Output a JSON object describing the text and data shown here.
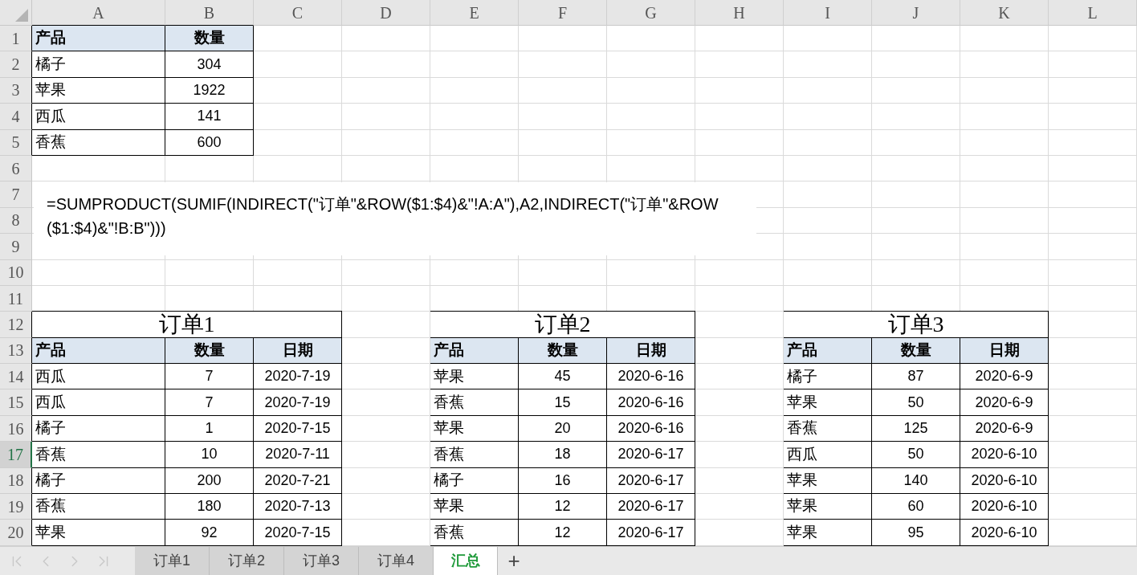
{
  "column_headers": [
    {
      "label": "A"
    },
    {
      "label": "B"
    },
    {
      "label": "C"
    },
    {
      "label": "D"
    },
    {
      "label": "E"
    },
    {
      "label": "F"
    },
    {
      "label": "G"
    },
    {
      "label": "H"
    },
    {
      "label": "I"
    },
    {
      "label": "J"
    },
    {
      "label": "K"
    },
    {
      "label": "L"
    }
  ],
  "rows": [
    {
      "number": "1",
      "selected": false,
      "cells": [
        {
          "kind": "label_header",
          "text": "产品"
        },
        {
          "kind": "value_header",
          "text": "数量"
        }
      ]
    },
    {
      "number": "2",
      "selected": false,
      "cells": [
        {
          "kind": "text",
          "text": "橘子"
        },
        {
          "kind": "number",
          "text": "304"
        }
      ]
    },
    {
      "number": "3",
      "selected": false,
      "cells": [
        {
          "kind": "text",
          "text": "苹果"
        },
        {
          "kind": "number",
          "text": "1922"
        }
      ]
    },
    {
      "number": "4",
      "selected": false,
      "cells": [
        {
          "kind": "text",
          "text": "西瓜"
        },
        {
          "kind": "number",
          "text": "141"
        }
      ]
    },
    {
      "number": "5",
      "selected": false,
      "cells": [
        {
          "kind": "text",
          "text": "香蕉"
        },
        {
          "kind": "number",
          "text": "600"
        }
      ]
    },
    {
      "number": "6",
      "selected": false
    },
    {
      "number": "7",
      "selected": false
    },
    {
      "number": "8",
      "selected": false
    },
    {
      "number": "9",
      "selected": false
    },
    {
      "number": "10",
      "selected": false
    },
    {
      "number": "11",
      "selected": false
    },
    {
      "number": "12",
      "selected": false,
      "cells": [
        {
          "kind": "title",
          "text": "订单1"
        },
        {
          "kind": "merged"
        },
        {
          "kind": "merged"
        },
        {
          "kind": "empty"
        },
        {
          "kind": "title",
          "text": "订单2"
        },
        {
          "kind": "merged"
        },
        {
          "kind": "merged"
        },
        {
          "kind": "empty"
        },
        {
          "kind": "title",
          "text": "订单3"
        },
        {
          "kind": "merged"
        },
        {
          "kind": "merged"
        }
      ]
    },
    {
      "number": "13",
      "selected": false,
      "cells": [
        {
          "kind": "label_header",
          "text": "产品"
        },
        {
          "kind": "value_header",
          "text": "数量"
        },
        {
          "kind": "value_header",
          "text": "日期"
        },
        {
          "kind": "empty"
        },
        {
          "kind": "label_header",
          "text": "产品"
        },
        {
          "kind": "value_header",
          "text": "数量"
        },
        {
          "kind": "value_header",
          "text": "日期"
        },
        {
          "kind": "empty"
        },
        {
          "kind": "label_header",
          "text": "产品"
        },
        {
          "kind": "value_header",
          "text": "数量"
        },
        {
          "kind": "value_header",
          "text": "日期"
        }
      ]
    },
    {
      "number": "14",
      "selected": false,
      "cells": [
        {
          "kind": "text",
          "text": "西瓜"
        },
        {
          "kind": "number",
          "text": "7"
        },
        {
          "kind": "date",
          "text": "2020-7-19"
        },
        {
          "kind": "empty"
        },
        {
          "kind": "text",
          "text": "苹果"
        },
        {
          "kind": "number",
          "text": "45"
        },
        {
          "kind": "date",
          "text": "2020-6-16"
        },
        {
          "kind": "empty"
        },
        {
          "kind": "text",
          "text": "橘子"
        },
        {
          "kind": "number",
          "text": "87"
        },
        {
          "kind": "date",
          "text": "2020-6-9"
        }
      ]
    },
    {
      "number": "15",
      "selected": false,
      "cells": [
        {
          "kind": "text",
          "text": "西瓜"
        },
        {
          "kind": "number",
          "text": "7"
        },
        {
          "kind": "date",
          "text": "2020-7-19"
        },
        {
          "kind": "empty"
        },
        {
          "kind": "text",
          "text": "香蕉"
        },
        {
          "kind": "number",
          "text": "15"
        },
        {
          "kind": "date",
          "text": "2020-6-16"
        },
        {
          "kind": "empty"
        },
        {
          "kind": "text",
          "text": "苹果"
        },
        {
          "kind": "number",
          "text": "50"
        },
        {
          "kind": "date",
          "text": "2020-6-9"
        }
      ]
    },
    {
      "number": "16",
      "selected": false,
      "cells": [
        {
          "kind": "text",
          "text": "橘子"
        },
        {
          "kind": "number",
          "text": "1"
        },
        {
          "kind": "date",
          "text": "2020-7-15"
        },
        {
          "kind": "empty"
        },
        {
          "kind": "text",
          "text": "苹果"
        },
        {
          "kind": "number",
          "text": "20"
        },
        {
          "kind": "date",
          "text": "2020-6-16"
        },
        {
          "kind": "empty"
        },
        {
          "kind": "text",
          "text": "香蕉"
        },
        {
          "kind": "number",
          "text": "125"
        },
        {
          "kind": "date",
          "text": "2020-6-9"
        }
      ]
    },
    {
      "number": "17",
      "selected": true,
      "cells": [
        {
          "kind": "text",
          "text": "香蕉"
        },
        {
          "kind": "number",
          "text": "10"
        },
        {
          "kind": "date",
          "text": "2020-7-11"
        },
        {
          "kind": "empty"
        },
        {
          "kind": "text",
          "text": "香蕉"
        },
        {
          "kind": "number",
          "text": "18"
        },
        {
          "kind": "date",
          "text": "2020-6-17"
        },
        {
          "kind": "empty"
        },
        {
          "kind": "text",
          "text": "西瓜"
        },
        {
          "kind": "number",
          "text": "50"
        },
        {
          "kind": "date",
          "text": "2020-6-10"
        }
      ]
    },
    {
      "number": "18",
      "selected": false,
      "cells": [
        {
          "kind": "text",
          "text": "橘子"
        },
        {
          "kind": "number",
          "text": "200"
        },
        {
          "kind": "date",
          "text": "2020-7-21"
        },
        {
          "kind": "empty"
        },
        {
          "kind": "text",
          "text": "橘子"
        },
        {
          "kind": "number",
          "text": "16"
        },
        {
          "kind": "date",
          "text": "2020-6-17"
        },
        {
          "kind": "empty"
        },
        {
          "kind": "text",
          "text": "苹果"
        },
        {
          "kind": "number",
          "text": "140"
        },
        {
          "kind": "date",
          "text": "2020-6-10"
        }
      ]
    },
    {
      "number": "19",
      "selected": false,
      "cells": [
        {
          "kind": "text",
          "text": "香蕉"
        },
        {
          "kind": "number",
          "text": "180"
        },
        {
          "kind": "date",
          "text": "2020-7-13"
        },
        {
          "kind": "empty"
        },
        {
          "kind": "text",
          "text": "苹果"
        },
        {
          "kind": "number",
          "text": "12"
        },
        {
          "kind": "date",
          "text": "2020-6-17"
        },
        {
          "kind": "empty"
        },
        {
          "kind": "text",
          "text": "苹果"
        },
        {
          "kind": "number",
          "text": "60"
        },
        {
          "kind": "date",
          "text": "2020-6-10"
        }
      ]
    },
    {
      "number": "20",
      "selected": false,
      "cells": [
        {
          "kind": "text",
          "text": "苹果"
        },
        {
          "kind": "number",
          "text": "92"
        },
        {
          "kind": "date",
          "text": "2020-7-15"
        },
        {
          "kind": "empty"
        },
        {
          "kind": "text",
          "text": "香蕉"
        },
        {
          "kind": "number",
          "text": "12"
        },
        {
          "kind": "date",
          "text": "2020-6-17"
        },
        {
          "kind": "empty"
        },
        {
          "kind": "text",
          "text": "苹果"
        },
        {
          "kind": "number",
          "text": "95"
        },
        {
          "kind": "date",
          "text": "2020-6-10"
        }
      ]
    }
  ],
  "text_box": {
    "text": "=SUMPRODUCT(SUMIF(INDIRECT(\"订单\"&ROW($1:$4)&\"!A:A\"),A2,INDIRECT(\"订单\"&ROW($1:$4)&\"!B:B\")))"
  },
  "sheet_tabs": [
    {
      "label": "订单1",
      "selected": false
    },
    {
      "label": "订单2",
      "selected": false
    },
    {
      "label": "订单3",
      "selected": false
    },
    {
      "label": "订单4",
      "selected": false
    },
    {
      "label": "汇总",
      "selected": true
    }
  ],
  "add_sheet": {
    "label": "+"
  }
}
